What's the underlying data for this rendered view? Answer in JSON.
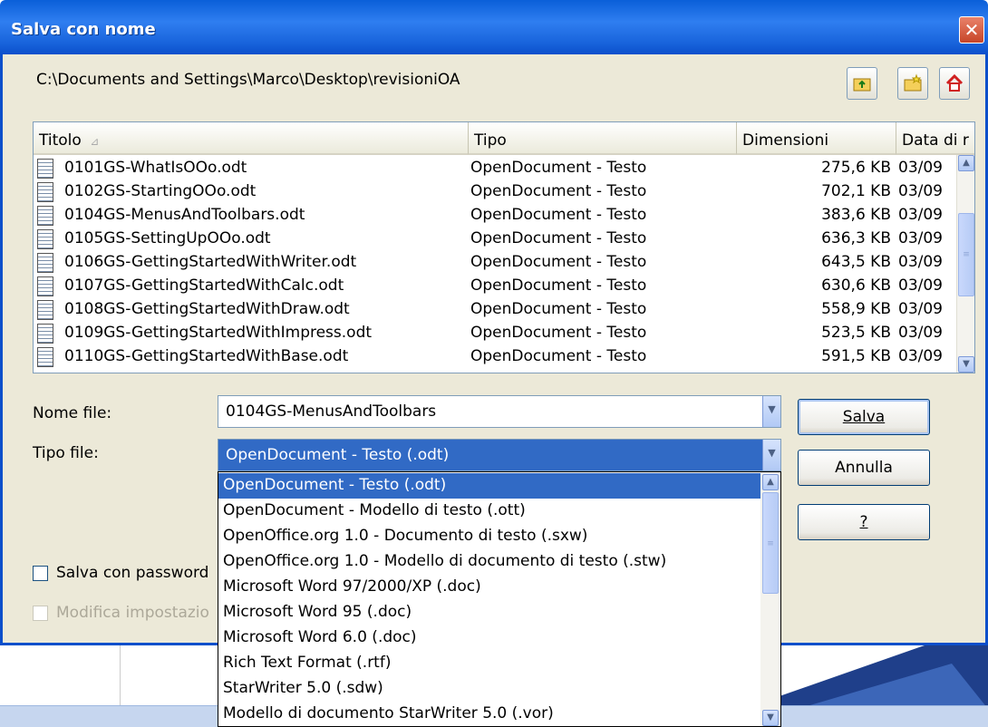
{
  "window": {
    "title": "Salva con nome",
    "close_symbol": "✕"
  },
  "path": "C:\\Documents and Settings\\Marco\\Desktop\\revisioniOA",
  "toolbar": {
    "up_icon": "folder-up-icon",
    "new_folder_icon": "new-folder-icon",
    "home_icon": "home-icon"
  },
  "columns": {
    "title": "Titolo",
    "sort_arrow": "⊿",
    "type": "Tipo",
    "size": "Dimensioni",
    "date": "Data di r"
  },
  "files": [
    {
      "name": "0101GS-WhatIsOOo.odt",
      "type": "OpenDocument - Testo",
      "size": "275,6 KB",
      "date": "03/09"
    },
    {
      "name": "0102GS-StartingOOo.odt",
      "type": "OpenDocument - Testo",
      "size": "702,1 KB",
      "date": "03/09"
    },
    {
      "name": "0104GS-MenusAndToolbars.odt",
      "type": "OpenDocument - Testo",
      "size": "383,6 KB",
      "date": "03/09"
    },
    {
      "name": "0105GS-SettingUpOOo.odt",
      "type": "OpenDocument - Testo",
      "size": "636,3 KB",
      "date": "03/09"
    },
    {
      "name": "0106GS-GettingStartedWithWriter.odt",
      "type": "OpenDocument - Testo",
      "size": "643,5 KB",
      "date": "03/09"
    },
    {
      "name": "0107GS-GettingStartedWithCalc.odt",
      "type": "OpenDocument - Testo",
      "size": "630,6 KB",
      "date": "03/09"
    },
    {
      "name": "0108GS-GettingStartedWithDraw.odt",
      "type": "OpenDocument - Testo",
      "size": "558,9 KB",
      "date": "03/09"
    },
    {
      "name": "0109GS-GettingStartedWithImpress.odt",
      "type": "OpenDocument - Testo",
      "size": "523,5 KB",
      "date": "03/09"
    },
    {
      "name": "0110GS-GettingStartedWithBase.odt",
      "type": "OpenDocument - Testo",
      "size": "591,5 KB",
      "date": "03/09"
    }
  ],
  "form": {
    "filename_label": "Nome file:",
    "filename_value": "0104GS-MenusAndToolbars",
    "filetype_label": "Tipo file:",
    "filetype_value": "OpenDocument - Testo (.odt)",
    "save_with_password": "Salva con password",
    "edit_filter_settings": "Modifica impostazio"
  },
  "buttons": {
    "save": "Salva",
    "cancel": "Annulla",
    "help": "?"
  },
  "filetype_options": [
    "OpenDocument - Testo (.odt)",
    "OpenDocument - Modello di testo (.ott)",
    "OpenOffice.org 1.0 - Documento di testo (.sxw)",
    "OpenOffice.org 1.0 - Modello di documento di testo (.stw)",
    "Microsoft Word 97/2000/XP (.doc)",
    "Microsoft Word 95 (.doc)",
    "Microsoft Word 6.0 (.doc)",
    "Rich Text Format (.rtf)",
    "StarWriter 5.0 (.sdw)",
    "Modello di documento StarWriter 5.0 (.vor)"
  ],
  "scroll_symbols": {
    "up": "▲",
    "down": "▼",
    "grip": "≡"
  },
  "colors": {
    "titlebar": "#0b4fcb",
    "selection": "#316ac5",
    "dialog_bg": "#ece9d8"
  }
}
